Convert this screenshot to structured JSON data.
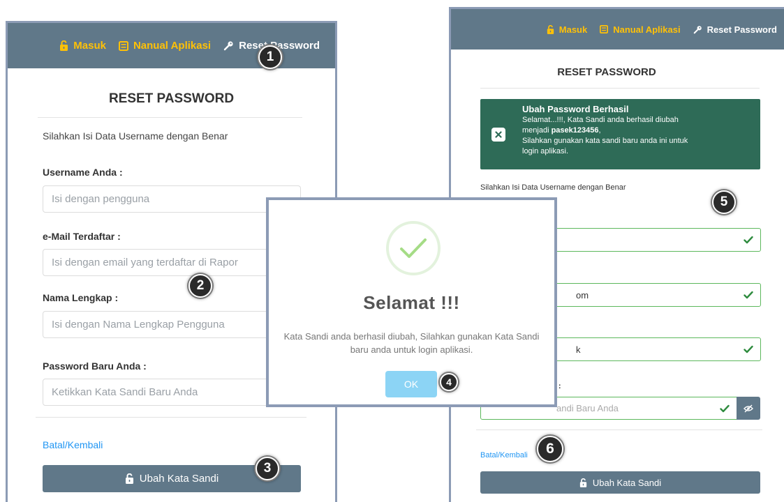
{
  "nav": {
    "login": "Masuk",
    "manual": "Nanual Aplikasi",
    "reset": "Reset Password"
  },
  "left_form": {
    "title": "RESET PASSWORD",
    "instruction": "Silahkan Isi Data Username dengan Benar",
    "username_label": "Username Anda :",
    "username_placeholder": "Isi dengan pengguna",
    "email_label": "e-Mail Terdaftar :",
    "email_placeholder": "Isi dengan email yang terdaftar di Rapor",
    "name_label": "Nama Lengkap :",
    "name_placeholder": "Isi dengan Nama Lengkap Pengguna",
    "password_label": "Password Baru Anda :",
    "password_placeholder": "Ketikkan Kata Sandi Baru Anda",
    "cancel_link": "Batal/Kembali",
    "submit_label": "Ubah Kata Sandi"
  },
  "modal": {
    "title": "Selamat !!!",
    "message": "Kata Sandi anda berhasil diubah, Silahkan gunakan Kata Sandi baru anda untuk login aplikasi.",
    "ok_label": "OK"
  },
  "right_form": {
    "title": "RESET PASSWORD",
    "alert_title": "Ubah Password Berhasil",
    "alert_line1": "Selamat...!!!, Kata Sandi anda berhasil diubah",
    "alert_prefix": "menjadi ",
    "alert_password": "pasek123456",
    "alert_suffix": ",",
    "alert_line3": "Silahkan gunakan kata sandi baru anda ini untuk",
    "alert_line4": "login aplikasi.",
    "instruction": "Silahkan Isi Data Username dengan Benar",
    "email_value_fragment": "om",
    "name_value_fragment": "k",
    "password_label_fragment": "da :",
    "password_placeholder_fragment": "andi Baru Anda",
    "cancel_link": "Batal/Kembali",
    "submit_label": "Ubah Kata Sandi"
  },
  "markers": [
    "1",
    "2",
    "3",
    "4",
    "5",
    "6"
  ],
  "colors": {
    "topbar": "#607889",
    "nav_accent": "#ffc107",
    "success_alert": "#2e6b57",
    "valid_border": "#5cb85c",
    "link": "#2196f3",
    "ok_button": "#8cd4f5"
  }
}
